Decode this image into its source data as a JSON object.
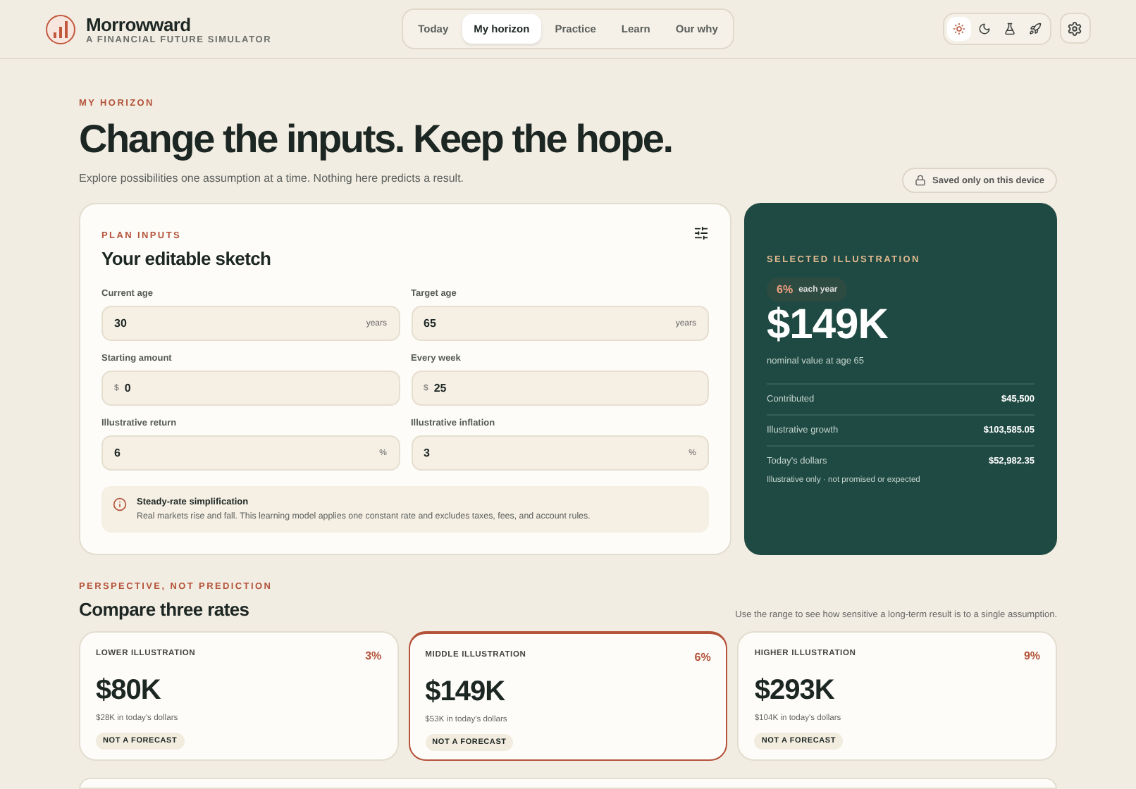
{
  "brand": {
    "name": "Morrowward",
    "tagline": "A FINANCIAL FUTURE SIMULATOR"
  },
  "nav": [
    {
      "label": "Today",
      "selected": false
    },
    {
      "label": "My horizon",
      "selected": true
    },
    {
      "label": "Practice",
      "selected": false
    },
    {
      "label": "Learn",
      "selected": false
    },
    {
      "label": "Our why",
      "selected": false
    }
  ],
  "themes": [
    {
      "kind": "sun",
      "selected": true
    },
    {
      "kind": "moon",
      "selected": false
    },
    {
      "kind": "flask",
      "selected": false
    },
    {
      "kind": "rocket",
      "selected": false
    }
  ],
  "page": {
    "eyebrow": "MY HORIZON",
    "title": "Change the inputs. Keep the hope.",
    "subtitle": "Explore possibilities one assumption at a time. Nothing here predicts a result.",
    "saved_badge": "Saved only on this device"
  },
  "inputs": {
    "eyebrow": "PLAN INPUTS",
    "title": "Your editable sketch",
    "fields": [
      {
        "label": "Current age",
        "value": "30",
        "suffix": "years"
      },
      {
        "label": "Target age",
        "value": "65",
        "suffix": "years"
      },
      {
        "label": "Starting amount",
        "value": "0",
        "prefix": "$"
      },
      {
        "label": "Every week",
        "value": "25",
        "prefix": "$"
      },
      {
        "label": "Illustrative return",
        "value": "6",
        "suffix": "%"
      },
      {
        "label": "Illustrative inflation",
        "value": "3",
        "suffix": "%"
      }
    ],
    "note": {
      "title": "Steady-rate simplification",
      "text": "Real markets rise and fall. This learning model applies one constant rate and excludes taxes, fees, and account rules."
    }
  },
  "selected": {
    "eyebrow": "SELECTED ILLUSTRATION",
    "rate": "6%",
    "rate_label": "each year",
    "amount": "$149K",
    "caption": "nominal value at age 65",
    "rows": [
      {
        "label": "Contributed",
        "value": "$45,500"
      },
      {
        "label": "Illustrative growth",
        "value": "$103,585.05"
      },
      {
        "label": "Today's dollars",
        "value": "$52,982.35"
      }
    ],
    "footnote": "Illustrative only · not promised or expected"
  },
  "compare": {
    "eyebrow": "PERSPECTIVE, NOT PREDICTION",
    "title": "Compare three rates",
    "hint": "Use the range to see how sensitive a long-term result is to a single assumption.",
    "cards": [
      {
        "label": "LOWER ILLUSTRATION",
        "rate": "3%",
        "amount": "$80K",
        "today": "$28K in today's dollars",
        "tag": "NOT A FORECAST",
        "selected": false
      },
      {
        "label": "MIDDLE ILLUSTRATION",
        "rate": "6%",
        "amount": "$149K",
        "today": "$53K in today's dollars",
        "tag": "NOT A FORECAST",
        "selected": true
      },
      {
        "label": "HIGHER ILLUSTRATION",
        "rate": "9%",
        "amount": "$293K",
        "today": "$104K in today's dollars",
        "tag": "NOT A FORECAST",
        "selected": false
      }
    ]
  }
}
